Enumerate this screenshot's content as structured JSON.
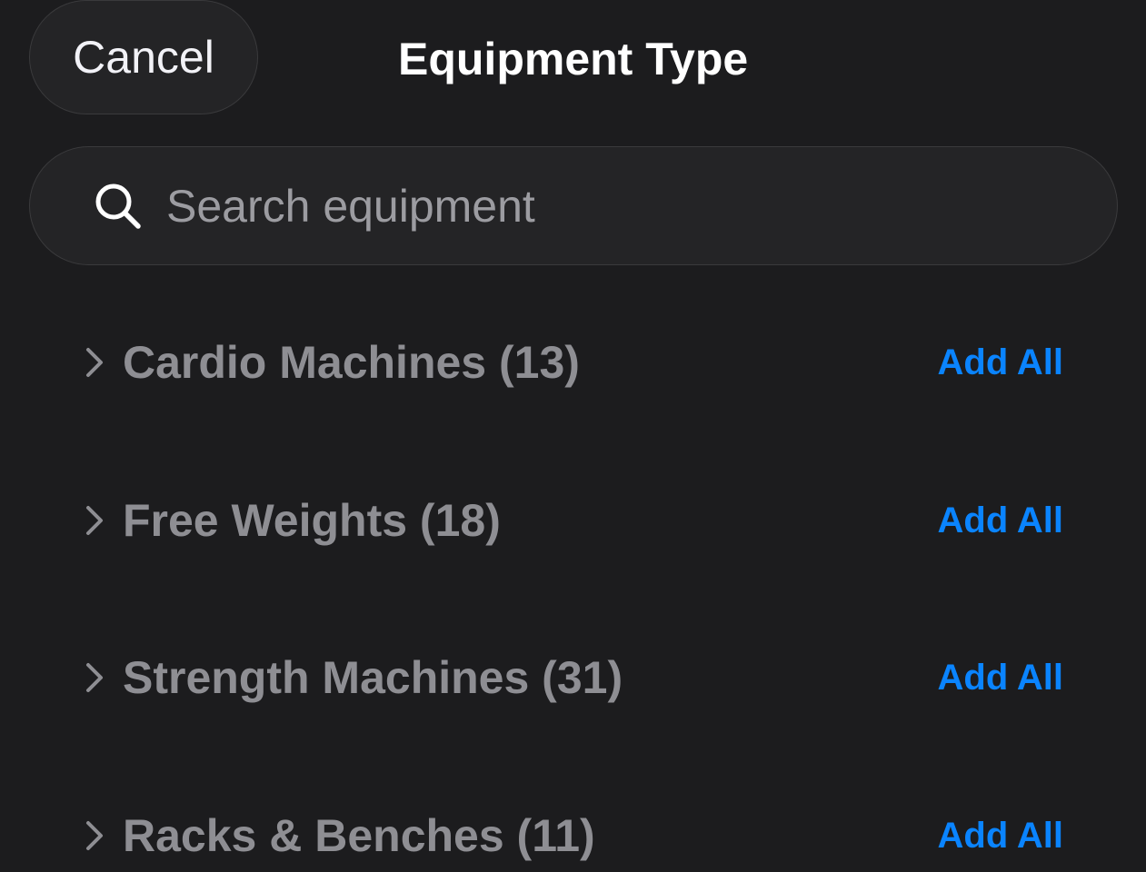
{
  "header": {
    "cancel_label": "Cancel",
    "title": "Equipment Type"
  },
  "search": {
    "placeholder": "Search equipment",
    "value": "",
    "icon": "search-icon"
  },
  "categories": [
    {
      "name": "Cardio Machines",
      "count": 13,
      "label": "Cardio Machines (13)",
      "action_label": "Add All"
    },
    {
      "name": "Free Weights",
      "count": 18,
      "label": "Free Weights (18)",
      "action_label": "Add All"
    },
    {
      "name": "Strength Machines",
      "count": 31,
      "label": "Strength Machines (31)",
      "action_label": "Add All"
    },
    {
      "name": "Racks & Benches",
      "count": 11,
      "label": "Racks & Benches (11)",
      "action_label": "Add All"
    }
  ],
  "colors": {
    "background": "#1c1c1e",
    "accent": "#0a84ff",
    "category_text": "#8e8e93",
    "title_text": "#ffffff"
  }
}
